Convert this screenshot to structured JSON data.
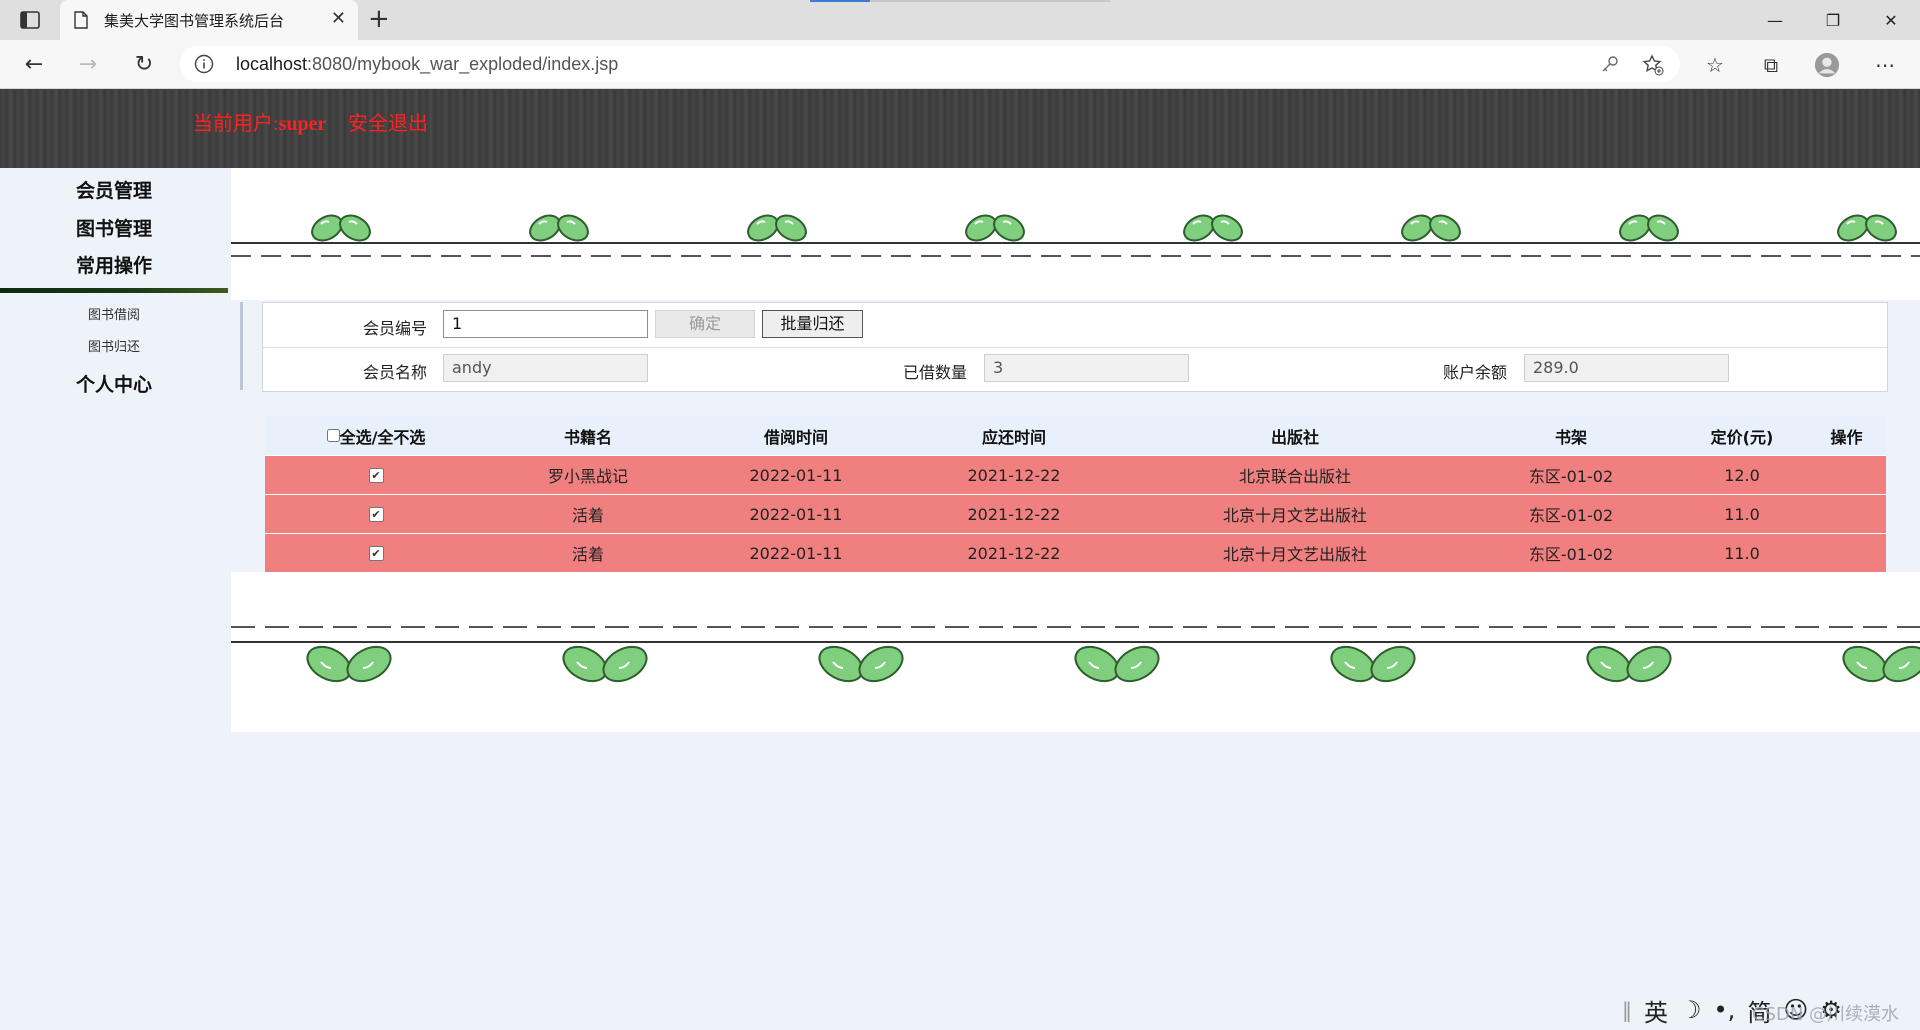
{
  "browser": {
    "tab_title": "集美大学图书管理系统后台",
    "url_host": "localhost",
    "url_rest": ":8080/mybook_war_exploded/index.jsp"
  },
  "header": {
    "user_prefix": "当前用户:",
    "user_name": "super",
    "logout": "安全退出"
  },
  "sidebar": {
    "items": [
      "会员管理",
      "图书管理",
      "常用操作"
    ],
    "sub_items": [
      "图书借阅",
      "图书归还"
    ],
    "personal": "个人中心"
  },
  "form": {
    "member_id_label": "会员编号",
    "member_id_value": "1",
    "confirm_label": "确定",
    "batch_return_label": "批量归还",
    "member_name_label": "会员名称",
    "member_name_value": "andy",
    "borrowed_label": "已借数量",
    "borrowed_value": "3",
    "balance_label": "账户余额",
    "balance_value": "289.0"
  },
  "table": {
    "headers": [
      "全选/全不选",
      "书籍名",
      "借阅时间",
      "应还时间",
      "出版社",
      "书架",
      "定价(元)",
      "操作"
    ],
    "rows": [
      {
        "checked": true,
        "name": "罗小黑战记",
        "borrow": "2022-01-11",
        "due": "2021-12-22",
        "publisher": "北京联合出版社",
        "shelf": "东区-01-02",
        "price": "12.0",
        "op": ""
      },
      {
        "checked": true,
        "name": "活着",
        "borrow": "2022-01-11",
        "due": "2021-12-22",
        "publisher": "北京十月文艺出版社",
        "shelf": "东区-01-02",
        "price": "11.0",
        "op": ""
      },
      {
        "checked": true,
        "name": "活着",
        "borrow": "2022-01-11",
        "due": "2021-12-22",
        "publisher": "北京十月文艺出版社",
        "shelf": "东区-01-02",
        "price": "11.0",
        "op": ""
      }
    ]
  },
  "ime": {
    "lang": "英",
    "mode": "简",
    "watermark": "CSDN @川续漠水"
  },
  "colors": {
    "row_highlight": "#f08080",
    "header_text": "#ff2020",
    "table_header_bg": "#e7f0fb"
  }
}
